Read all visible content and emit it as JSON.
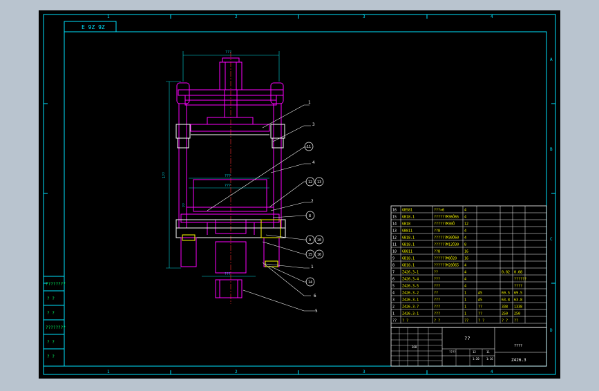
{
  "drawing": {
    "stamp": "E 9Z 9Z",
    "top_zones": [
      "1",
      "2",
      "3",
      "4"
    ],
    "bottom_zones": [
      "1",
      "2",
      "3",
      "4"
    ],
    "right_zones": [
      "A",
      "B",
      "C",
      "D"
    ],
    "balloons_plain": [
      "1",
      "3",
      "4",
      "2",
      "1",
      "6",
      "5"
    ],
    "balloons_circled": [
      "11",
      "12",
      "13",
      "8",
      "9",
      "10",
      "15",
      "16",
      "14"
    ],
    "dim_top": "???",
    "dim_height": "1??",
    "dim_mid1": "???",
    "dim_mid2": "???",
    "dim_side": "??",
    "dim_bottom": "???"
  },
  "left_stamp_column": [
    "????????",
    "? ?",
    "? ?",
    "????????",
    "? ?",
    "? ?"
  ],
  "bom": {
    "rows": [
      [
        "16",
        "GB581",
        "???×6",
        "4",
        "",
        "",
        ""
      ],
      [
        "15",
        "GB18.1",
        "??????M36Ô65",
        "4",
        "",
        "",
        ""
      ],
      [
        "14",
        "GB18",
        "??????M30Ô",
        "12",
        "",
        "",
        ""
      ],
      [
        "13",
        "GB811",
        "??8",
        "4",
        "",
        "",
        ""
      ],
      [
        "12",
        "GB18.1",
        "??????M30Ô60",
        "4",
        "",
        "",
        ""
      ],
      [
        "11",
        "GB18.1",
        "??????M12Ô30",
        "8",
        "",
        "",
        ""
      ],
      [
        "10",
        "GB811",
        "??8",
        "16",
        "",
        "",
        ""
      ],
      [
        "9",
        "GB18.1",
        "??????M8Ô20",
        "16",
        "",
        "",
        ""
      ],
      [
        "8",
        "GB18.1",
        "??????M28Ô65",
        "4",
        "",
        "",
        ""
      ],
      [
        "7",
        "Z426.3-1",
        "??",
        "4",
        "",
        "0.02",
        "0.08"
      ],
      [
        "6",
        "Z426.3-4",
        "???",
        "4",
        "",
        "",
        "??????"
      ],
      [
        "5",
        "Z426.3-5",
        "???",
        "4",
        "",
        "",
        "????"
      ],
      [
        "4",
        "Z426.3-2",
        "??",
        "1",
        "A5",
        "69.5",
        "69.5"
      ],
      [
        "3",
        "Z426.3-1",
        "???",
        "1",
        "A5",
        "63.8",
        "63.8"
      ],
      [
        "2",
        "Z426.3-7",
        "???",
        "1",
        "??",
        "338",
        "1338"
      ],
      [
        "1",
        "Z426.3-1",
        "???",
        "1",
        "??",
        "250",
        "250"
      ]
    ],
    "header": [
      "??",
      "? ?",
      "? ?",
      "??",
      "? ?",
      "? ?",
      "??"
    ]
  },
  "title_block": {
    "main_title": "??",
    "right_text": "????",
    "drawing_number": "Z426.3",
    "small1": "????",
    "small2": "12",
    "small3": "11",
    "small4": "1:20",
    "small5": "1:16",
    "small6": "368"
  },
  "colors": {
    "background": "#000000",
    "frame": "#00e5ff",
    "machine": "#ff00ff",
    "table_text": "#ffff00",
    "leader": "#ffffff",
    "green_text": "#00ff66",
    "dimension": "#00d5e0"
  }
}
